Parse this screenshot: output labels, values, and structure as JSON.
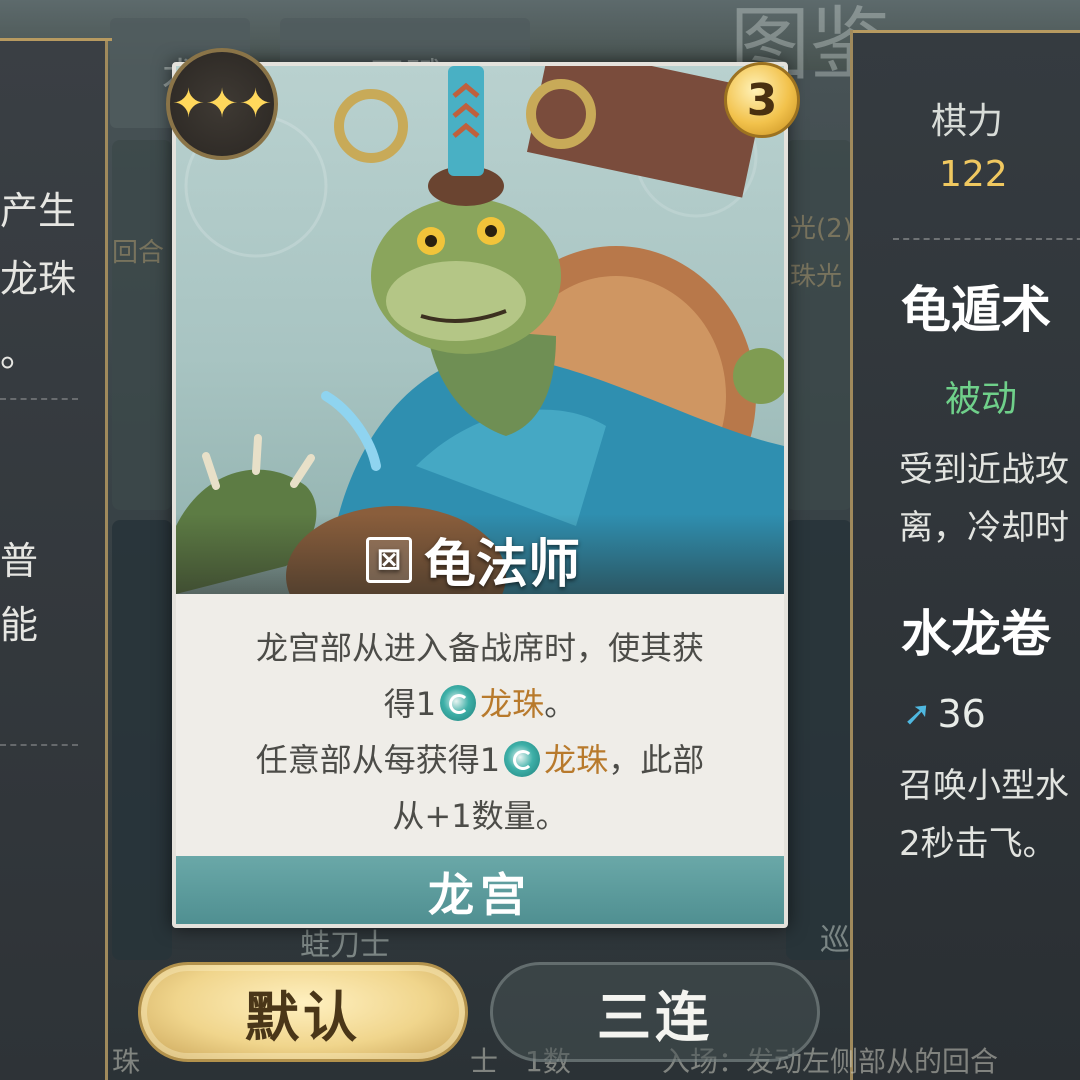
{
  "background": {
    "title": "图鉴",
    "tab1": "术",
    "tab2": "天赋",
    "snippet1": "回合",
    "snippet2": "光(2)",
    "snippet3": "珠光",
    "unit_left": "蛙刀士",
    "unit_right": "巡海夜叉",
    "strip_left": "珠",
    "strip_mid": "士",
    "strip_count": "1数",
    "strip_right": "入场：发动左侧部从的回合"
  },
  "left_panel": {
    "lines": [
      "产生",
      "龙珠",
      "。",
      "普",
      "能"
    ]
  },
  "card": {
    "stars": "✦✦✦",
    "cost": "3",
    "name": "龟法师",
    "desc_line1": "龙宫部从进入备战席时，使其获",
    "desc_line2_pre": "得1",
    "desc_line2_kw": "龙珠",
    "desc_line2_post": "。",
    "desc_line3_pre": "任意部从每获得1",
    "desc_line3_kw": "龙珠",
    "desc_line3_post": "，此部",
    "desc_line4": "从+1数量。",
    "faction": "龙宫"
  },
  "right_panel": {
    "stat_label": "棋力",
    "stat_value": "122",
    "skill1_name": "龟遁术",
    "skill1_type": "被动",
    "skill1_desc1": "受到近战攻",
    "skill1_desc2": "离，冷却时",
    "skill2_name": "水龙卷",
    "skill2_mana": "36",
    "skill2_desc1": "召唤小型水",
    "skill2_desc2": "2秒击飞。"
  },
  "buttons": {
    "default": "默认",
    "triple": "三连"
  },
  "colors": {
    "gold": "#f0c860",
    "passive_green": "#6fd08a",
    "keyword": "#b87a2c",
    "faction_teal": "#5a9a9b"
  }
}
